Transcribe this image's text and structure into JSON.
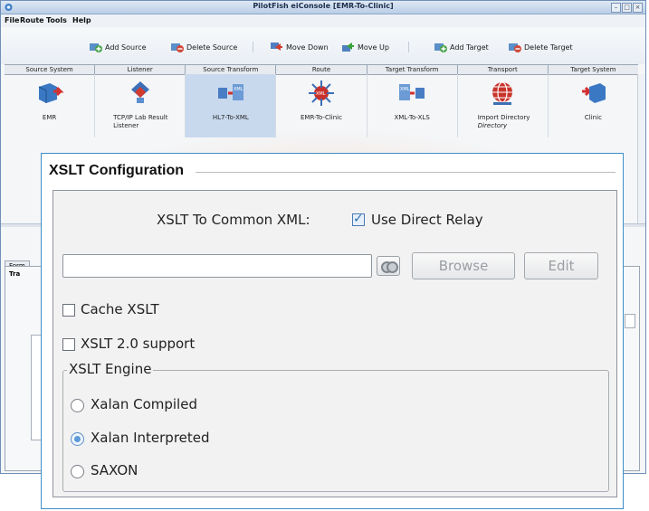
{
  "window": {
    "title": "PilotFish eiConsole [EMR-To-Clinic]",
    "controls": [
      "minimize",
      "maximize",
      "close"
    ]
  },
  "menu": [
    "File",
    "Route",
    "Tools",
    "Help"
  ],
  "toolbar": {
    "add_source": "Add Source",
    "delete_source": "Delete Source",
    "move_down": "Move Down",
    "move_up": "Move Up",
    "add_target": "Add Target",
    "delete_target": "Delete Target"
  },
  "stages": {
    "headers": [
      "Source System",
      "Listener",
      "Source Transform",
      "Route",
      "Target Transform",
      "Transport",
      "Target System"
    ],
    "items": [
      {
        "label": "EMR",
        "icon": "source-system-icon"
      },
      {
        "label": "TCP/IP Lab Result Listener",
        "icon": "listener-icon"
      },
      {
        "label": "HL7-To-XML",
        "icon": "source-transform-icon",
        "selected": true
      },
      {
        "label": "EMR-To-Clinic",
        "icon": "route-icon"
      },
      {
        "label": "XML-To-XLS",
        "icon": "target-transform-icon"
      },
      {
        "label": "Import Directory",
        "sub": "Directory",
        "icon": "transport-icon"
      },
      {
        "label": "Clinic",
        "icon": "target-system-icon"
      }
    ]
  },
  "bottom": {
    "tab": "Form",
    "section": "Tra"
  },
  "xslt": {
    "title": "XSLT Configuration",
    "to_common_label": "XSLT To Common XML:",
    "use_direct_relay_label": "Use Direct Relay",
    "use_direct_relay_checked": true,
    "path_value": "",
    "browse_label": "Browse",
    "edit_label": "Edit",
    "cache_label": "Cache XSLT",
    "cache_checked": false,
    "xslt2_label": "XSLT 2.0 support",
    "xslt2_checked": false,
    "engine": {
      "legend": "XSLT Engine",
      "options": [
        "Xalan Compiled",
        "Xalan Interpreted",
        "SAXON"
      ],
      "selected": "Xalan Interpreted"
    }
  },
  "colors": {
    "accent": "#3f8fc6",
    "selected_stage": "#c8d9ee",
    "radio_selected": "#5c9ad8"
  }
}
